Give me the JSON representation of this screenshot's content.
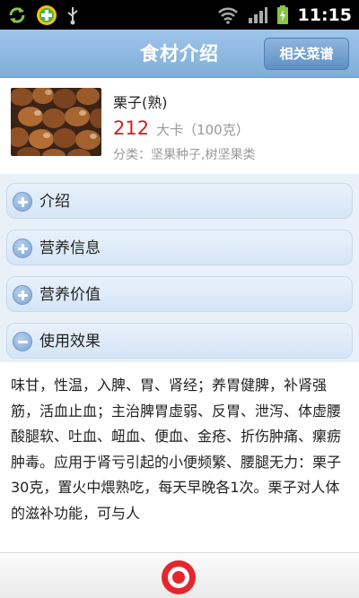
{
  "status_bar": {
    "time": "11:15",
    "icons": [
      "sync-icon",
      "app-icon",
      "usb-icon",
      "wifi-icon",
      "signal-icon",
      "battery-icon"
    ]
  },
  "header": {
    "title": "食材介绍",
    "related_recipes_label": "相关菜谱"
  },
  "food": {
    "name": "栗子(熟)",
    "calories": "212",
    "calorie_unit": "大卡（100克）",
    "category": "分类：坚果种子,树坚果类"
  },
  "sections": [
    {
      "label": "介绍",
      "expanded": false
    },
    {
      "label": "营养信息",
      "expanded": false
    },
    {
      "label": "营养价值",
      "expanded": false
    },
    {
      "label": "使用效果",
      "expanded": true
    }
  ],
  "content": {
    "text": "味甘，性温，入脾、胃、肾经；养胃健脾，补肾强筋，活血止血；主治脾胃虚弱、反胃、泄泻、体虚腰酸腿软、吐血、衄血、便血、金疮、折伤肿痛、瘰疬肿毒。应用于肾亏引起的小便频繁、腰腿无力：栗子30克，置火中煨熟吃，每天早晚各1次。栗子对人体的滋补功能，可与人"
  },
  "colors": {
    "accent": "#7fadd9",
    "calorie_red": "#d41e1e",
    "logo_red": "#e4262d"
  }
}
